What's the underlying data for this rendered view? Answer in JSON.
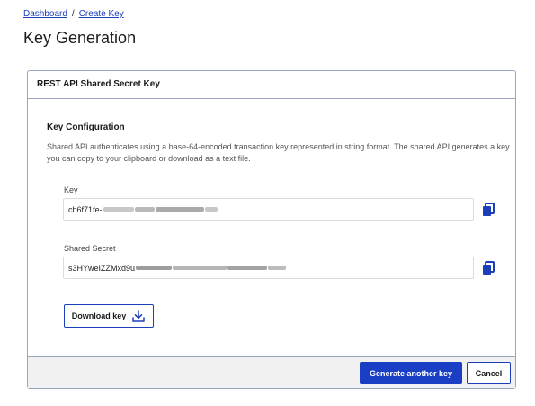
{
  "breadcrumb": {
    "items": [
      "Dashboard",
      "Create Key"
    ],
    "separator": "/"
  },
  "page": {
    "title": "Key Generation"
  },
  "card": {
    "header": "REST API Shared Secret Key"
  },
  "config": {
    "title": "Key Configuration",
    "description": "Shared API authenticates using a base-64-encoded transaction key represented in string format. The shared API generates a key you can copy to your clipboard or download as a text file."
  },
  "key_field": {
    "label": "Key",
    "value_visible": "cb6f71fe-",
    "redacted": true,
    "copy_icon": "copy-icon"
  },
  "secret_field": {
    "label": "Shared Secret",
    "value_visible": "s3HYweIZZMxd9u",
    "redacted": true,
    "copy_icon": "copy-icon"
  },
  "download": {
    "label": "Download key",
    "icon": "download-icon"
  },
  "footer": {
    "primary_label": "Generate another key",
    "secondary_label": "Cancel"
  },
  "colors": {
    "accent": "#1a3fc4",
    "link": "#1a3fb8",
    "border": "#9aa3c2",
    "footer_bg": "#f1f1f1"
  }
}
